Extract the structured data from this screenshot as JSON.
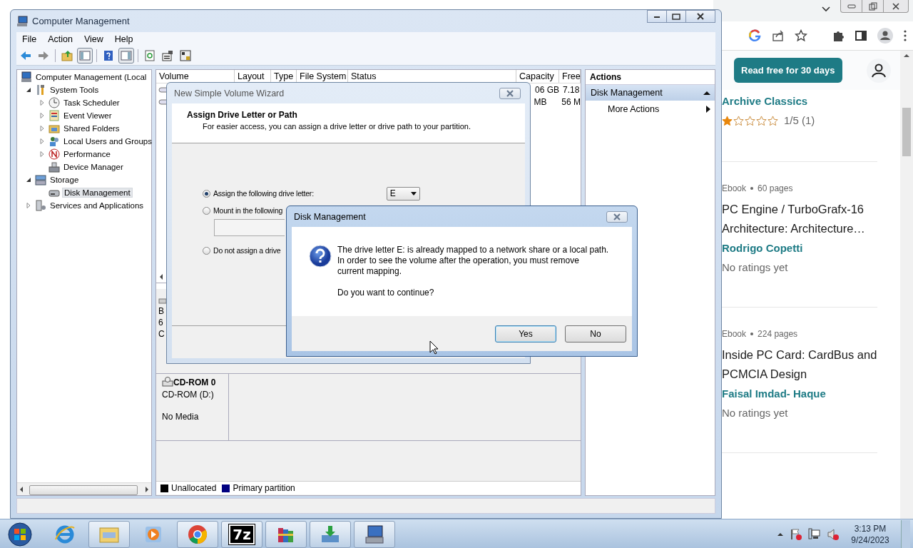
{
  "browser": {
    "cta": "Read free for 30 days",
    "books": [
      {
        "author": "Archive Classics",
        "stars": 1,
        "rating": "1/5 (1)"
      },
      {
        "format": "Ebook",
        "pages": "60 pages",
        "title": "PC Engine / TurboGrafx-16 Architecture: Architecture…",
        "author": "Rodrigo Copetti",
        "rating": "No ratings yet"
      },
      {
        "format": "Ebook",
        "pages": "224 pages",
        "title": "Inside PC Card: CardBus and PCMCIA Design",
        "author": "Faisal Imdad- Haque",
        "rating": "No ratings yet"
      }
    ]
  },
  "window": {
    "title": "Computer Management"
  },
  "menu": [
    "File",
    "Action",
    "View",
    "Help"
  ],
  "toolbar": [
    {
      "kind": "back",
      "pressed": false
    },
    {
      "kind": "forward",
      "pressed": false
    },
    {
      "kind": "up",
      "pressed": false
    },
    {
      "kind": "treepane",
      "pressed": true
    },
    {
      "kind": "help",
      "pressed": false
    },
    {
      "kind": "actionpane",
      "pressed": true
    },
    {
      "kind": "refresh",
      "pressed": false
    },
    {
      "kind": "properties",
      "pressed": false
    },
    {
      "kind": "settings",
      "pressed": false
    }
  ],
  "tree": [
    {
      "label": "Computer Management (Local",
      "kind": "computer",
      "selected": false,
      "children": [
        {
          "label": "System Tools",
          "kind": "tools",
          "selected": false,
          "expanded": true,
          "children": [
            {
              "label": "Task Scheduler",
              "kind": "clock",
              "selected": false,
              "expanded": false
            },
            {
              "label": "Event Viewer",
              "kind": "log",
              "selected": false,
              "expanded": false
            },
            {
              "label": "Shared Folders",
              "kind": "share",
              "selected": false,
              "expanded": false
            },
            {
              "label": "Local Users and Groups",
              "kind": "users",
              "selected": false,
              "expanded": false
            },
            {
              "label": "Performance",
              "kind": "performance",
              "selected": false,
              "expanded": false
            },
            {
              "label": "Device Manager",
              "kind": "device",
              "selected": false
            }
          ]
        },
        {
          "label": "Storage",
          "kind": "storage",
          "selected": false,
          "expanded": true,
          "children": [
            {
              "label": "Disk Management",
              "kind": "disk",
              "selected": true
            }
          ]
        },
        {
          "label": "Services and Applications",
          "kind": "services",
          "selected": false,
          "expanded": false
        }
      ]
    }
  ],
  "volume_table": {
    "columns": [
      "Volume",
      "Layout",
      "Type",
      "File System",
      "Status",
      "Capacity",
      "Free"
    ],
    "rows": [
      {
        "capacity": "06 GB",
        "free": "7.18"
      },
      {
        "capacity": "MB",
        "free": "56 M"
      }
    ]
  },
  "disks": {
    "disk_0_fragments": [
      "B",
      "6",
      "C"
    ],
    "cdrom": {
      "name": "CD-ROM 0",
      "drive": "CD-ROM (D:)",
      "media": "No Media"
    },
    "legend": [
      {
        "label": "Unallocated",
        "color": "#000000"
      },
      {
        "label": "Primary partition",
        "color": "#000080"
      }
    ]
  },
  "actions": {
    "title": "Actions",
    "section": "Disk Management",
    "items": [
      "More Actions"
    ]
  },
  "wizard": {
    "title": "New Simple Volume Wizard",
    "heading": "Assign Drive Letter or Path",
    "subtitle": "For easier access, you can assign a drive letter or drive path to your partition.",
    "options": [
      {
        "label": "Assign the following drive letter:",
        "selected": true
      },
      {
        "label": "Mount in the following",
        "selected": false
      },
      {
        "label": "Do not assign a drive",
        "selected": false
      }
    ],
    "drive_letter": "E"
  },
  "message_box": {
    "title": "Disk Management",
    "lines": [
      "The drive letter E: is already mapped to a network share or a local path.",
      "In order to see the volume after the operation, you must remove",
      "current mapping."
    ],
    "question": "Do you want to continue?",
    "buttons": [
      {
        "label": "Yes",
        "default": true
      },
      {
        "label": "No",
        "default": false
      }
    ]
  },
  "taskbar": {
    "apps": [
      {
        "kind": "ie",
        "running": false
      },
      {
        "kind": "explorer",
        "running": true
      },
      {
        "kind": "media",
        "running": false
      },
      {
        "kind": "chrome",
        "running": true
      },
      {
        "kind": "zip",
        "running": true,
        "label": "7z"
      },
      {
        "kind": "winrar",
        "running": true
      },
      {
        "kind": "download",
        "running": true
      },
      {
        "kind": "compmgmt",
        "running": true
      }
    ],
    "time": "3:13 PM",
    "date": "9/24/2023"
  }
}
